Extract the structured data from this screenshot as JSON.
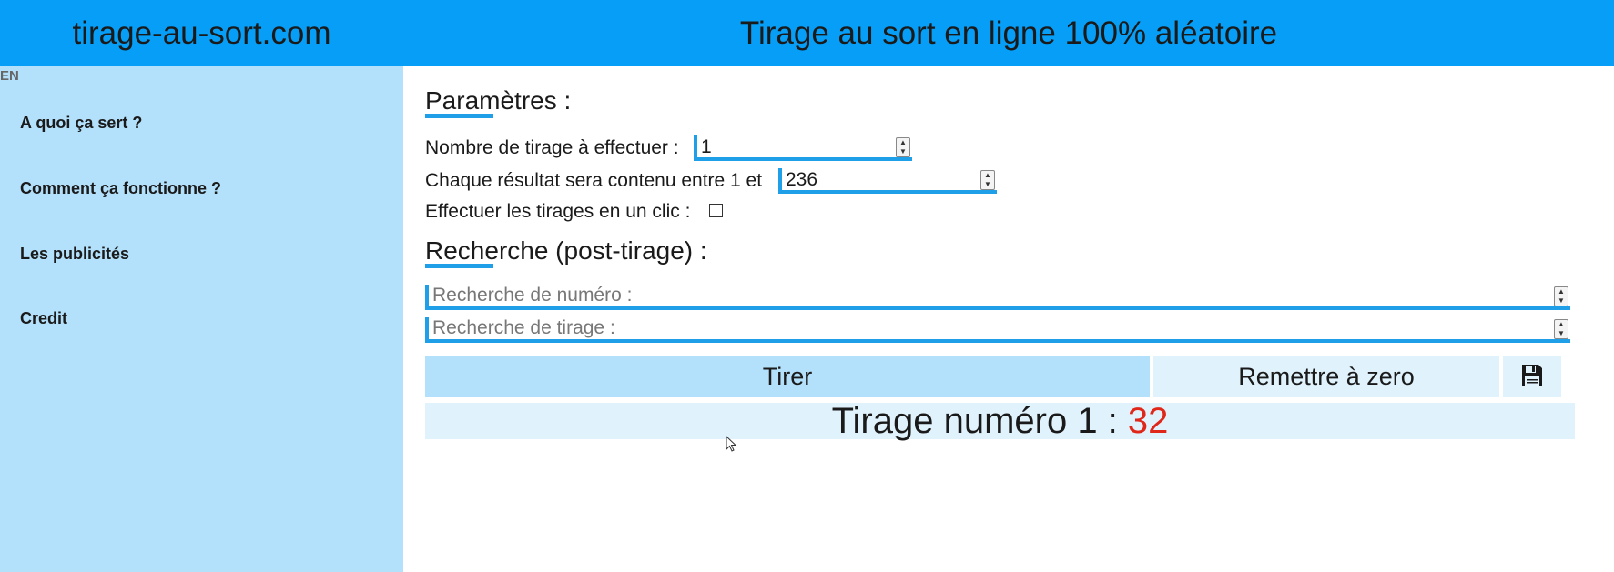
{
  "header": {
    "site_title": "tirage-au-sort.com",
    "heading": "Tirage au sort en ligne 100% aléatoire",
    "bg_color": "#069ef6"
  },
  "sidebar": {
    "lang": "EN",
    "items": [
      {
        "label": "A quoi ça sert ?"
      },
      {
        "label": "Comment ça fonctionne ?"
      },
      {
        "label": "Les publicités"
      },
      {
        "label": "Credit"
      }
    ],
    "bg_color": "#b3e0fb"
  },
  "params": {
    "title": "Paramètres :",
    "count_label": "Nombre de tirage à effectuer :",
    "count_value": "1",
    "range_label": "Chaque résultat sera contenu entre 1 et",
    "range_value": "236",
    "oneclick_label": "Effectuer les tirages en un clic :",
    "oneclick_checked": false
  },
  "search": {
    "title": "Recherche (post-tirage) :",
    "number_placeholder": "Recherche de numéro :",
    "draw_placeholder": "Recherche de tirage :"
  },
  "actions": {
    "draw_label": "Tirer",
    "reset_label": "Remettre à zero",
    "save_icon": "floppy-disk-icon"
  },
  "result": {
    "prefix": "Tirage numéro 1 :",
    "value": "32",
    "value_color": "#e0281a"
  }
}
